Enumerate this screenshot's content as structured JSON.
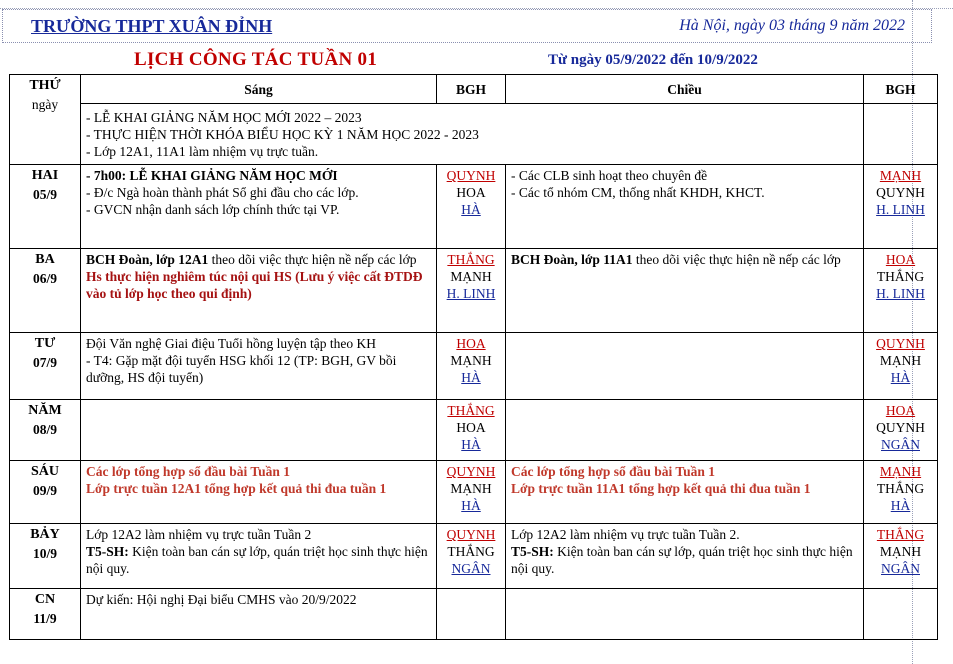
{
  "header": {
    "school": "TRƯỜNG THPT XUÂN ĐỈNH",
    "dateline": "Hà Nội, ngày 03 tháng  9  năm 2022",
    "title": "LỊCH CÔNG TÁC TUẦN 01",
    "range": "Từ ngày 05/9/2022 đến 10/9/2022"
  },
  "columns": {
    "day_label": "THỨ",
    "day_sub": "ngày",
    "morning": "Sáng",
    "bgh1": "BGH",
    "afternoon": "Chiều",
    "bgh2": "BGH"
  },
  "week_notes": [
    "- LỄ KHAI GIẢNG NĂM HỌC MỚI 2022 – 2023",
    "- THỰC HIỆN THỜI KHÓA BIỂU HỌC KỲ 1 NĂM HỌC 2022 - 2023",
    "- Lớp 12A1, 11A1 làm nhiệm vụ trực tuần."
  ],
  "rows": [
    {
      "day": "HAI",
      "date": "05/9",
      "morning": [
        {
          "text": "- 7h00: LỄ KHAI GIẢNG NĂM HỌC MỚI",
          "style": "b"
        },
        {
          "text": "- Đ/c Ngà hoàn thành phát Sổ ghi đầu cho các lớp.",
          "style": ""
        },
        {
          "text": "- GVCN nhận danh sách lớp chính thức tại VP.",
          "style": ""
        }
      ],
      "bgh1": [
        {
          "text": "QUYNH",
          "style": "red-u"
        },
        {
          "text": "HOA",
          "style": ""
        },
        {
          "text": "HÀ",
          "style": "blue-u"
        }
      ],
      "afternoon": [
        {
          "text": "- Các CLB sinh hoạt theo chuyên đề",
          "style": ""
        },
        {
          "text": "- Các tổ nhóm CM, thống nhất  KHDH, KHCT.",
          "style": ""
        }
      ],
      "bgh2": [
        {
          "text": "MẠNH",
          "style": "red-u"
        },
        {
          "text": "QUYNH",
          "style": ""
        },
        {
          "text": "H. LINH",
          "style": "blue-u"
        }
      ]
    },
    {
      "day": "BA",
      "date": "06/9",
      "morning_a_bold": "BCH Đoàn, lớp 12A1",
      "morning_a_rest": " theo dõi việc thực hiện nề nếp các lớp",
      "morning_b": "Hs thực hiện nghiêm túc nội qui HS (Lưu ý việc cất ĐTDĐ vào tủ lớp học theo qui định)",
      "bgh1": [
        {
          "text": "THẮNG",
          "style": "red-u"
        },
        {
          "text": "MẠNH",
          "style": ""
        },
        {
          "text": "H. LINH",
          "style": "blue-u"
        }
      ],
      "afternoon_a_bold": "BCH Đoàn, lớp 11A1",
      "afternoon_a_rest": " theo dõi việc thực hiện nề nếp các lớp",
      "bgh2": [
        {
          "text": "HOA",
          "style": "red-u"
        },
        {
          "text": "THẮNG",
          "style": ""
        },
        {
          "text": "H. LINH",
          "style": "blue-u"
        }
      ]
    },
    {
      "day": "TƯ",
      "date": "07/9",
      "morning": [
        {
          "text": "Đội Văn nghệ Giai điệu Tuổi hồng luyện tập theo KH",
          "style": ""
        },
        {
          "text": "- T4: Gặp mặt đội tuyển HSG khối 12 (TP: BGH, GV bồi dưỡng, HS đội tuyển)",
          "style": ""
        }
      ],
      "bgh1": [
        {
          "text": "HOA",
          "style": "red-u"
        },
        {
          "text": "MẠNH",
          "style": ""
        },
        {
          "text": "HÀ",
          "style": "blue-u"
        }
      ],
      "afternoon": [],
      "bgh2": [
        {
          "text": "QUYNH",
          "style": "red-u"
        },
        {
          "text": "MẠNH",
          "style": ""
        },
        {
          "text": "HÀ",
          "style": "blue-u"
        }
      ]
    },
    {
      "day": "NĂM",
      "date": "08/9",
      "morning": [],
      "bgh1": [
        {
          "text": "THẮNG",
          "style": "red-u"
        },
        {
          "text": "HOA",
          "style": ""
        },
        {
          "text": "HÀ",
          "style": "blue-u"
        }
      ],
      "afternoon": [],
      "bgh2": [
        {
          "text": "HOA",
          "style": "red-u"
        },
        {
          "text": "QUYNH",
          "style": ""
        },
        {
          "text": "NGÂN",
          "style": "blue-u"
        }
      ]
    },
    {
      "day": "SÁU",
      "date": "09/9",
      "morning": [
        {
          "text": "Các lớp tổng hợp sổ đầu bài Tuần 1",
          "style": "red-b"
        },
        {
          "text": "Lớp trực tuần 12A1 tổng hợp kết quả thi đua tuần 1",
          "style": "red-b"
        }
      ],
      "bgh1": [
        {
          "text": "QUYNH",
          "style": "red-u"
        },
        {
          "text": "MẠNH",
          "style": ""
        },
        {
          "text": "HÀ",
          "style": "blue-u"
        }
      ],
      "afternoon": [
        {
          "text": "Các lớp tổng hợp sổ đầu bài Tuần 1",
          "style": "red-b"
        },
        {
          "text": "Lớp trực tuần 11A1 tổng hợp kết quả thi đua tuần 1",
          "style": "red-b"
        }
      ],
      "bgh2": [
        {
          "text": "MẠNH",
          "style": "red-u"
        },
        {
          "text": "THẮNG",
          "style": ""
        },
        {
          "text": "HÀ",
          "style": "blue-u"
        }
      ]
    },
    {
      "day": "BẢY",
      "date": "10/9",
      "morning_a": "Lớp 12A2 làm nhiệm vụ trực tuần Tuần 2",
      "morning_b_bold": "T5-SH:",
      "morning_b_rest": " Kiện toàn ban cán sự lớp, quán triệt học sinh thực hiện nội quy.",
      "bgh1": [
        {
          "text": "QUYNH",
          "style": "red-u"
        },
        {
          "text": "THẮNG",
          "style": ""
        },
        {
          "text": "NGÂN",
          "style": "blue-u"
        }
      ],
      "afternoon_a": "Lớp 12A2 làm nhiệm vụ trực tuần Tuần 2.",
      "afternoon_b_bold": "T5-SH:",
      "afternoon_b_rest": " Kiện toàn ban cán sự lớp, quán triệt học sinh thực hiện nội quy.",
      "bgh2": [
        {
          "text": "THẮNG",
          "style": "red-u"
        },
        {
          "text": "MẠNH",
          "style": ""
        },
        {
          "text": "NGÂN",
          "style": "blue-u"
        }
      ]
    },
    {
      "day": "CN",
      "date": "11/9",
      "morning": [
        {
          "text": "Dự kiến: Hội nghị Đại biểu CMHS vào 20/9/2022",
          "style": ""
        }
      ],
      "bgh1": [],
      "afternoon": [],
      "bgh2": []
    }
  ]
}
